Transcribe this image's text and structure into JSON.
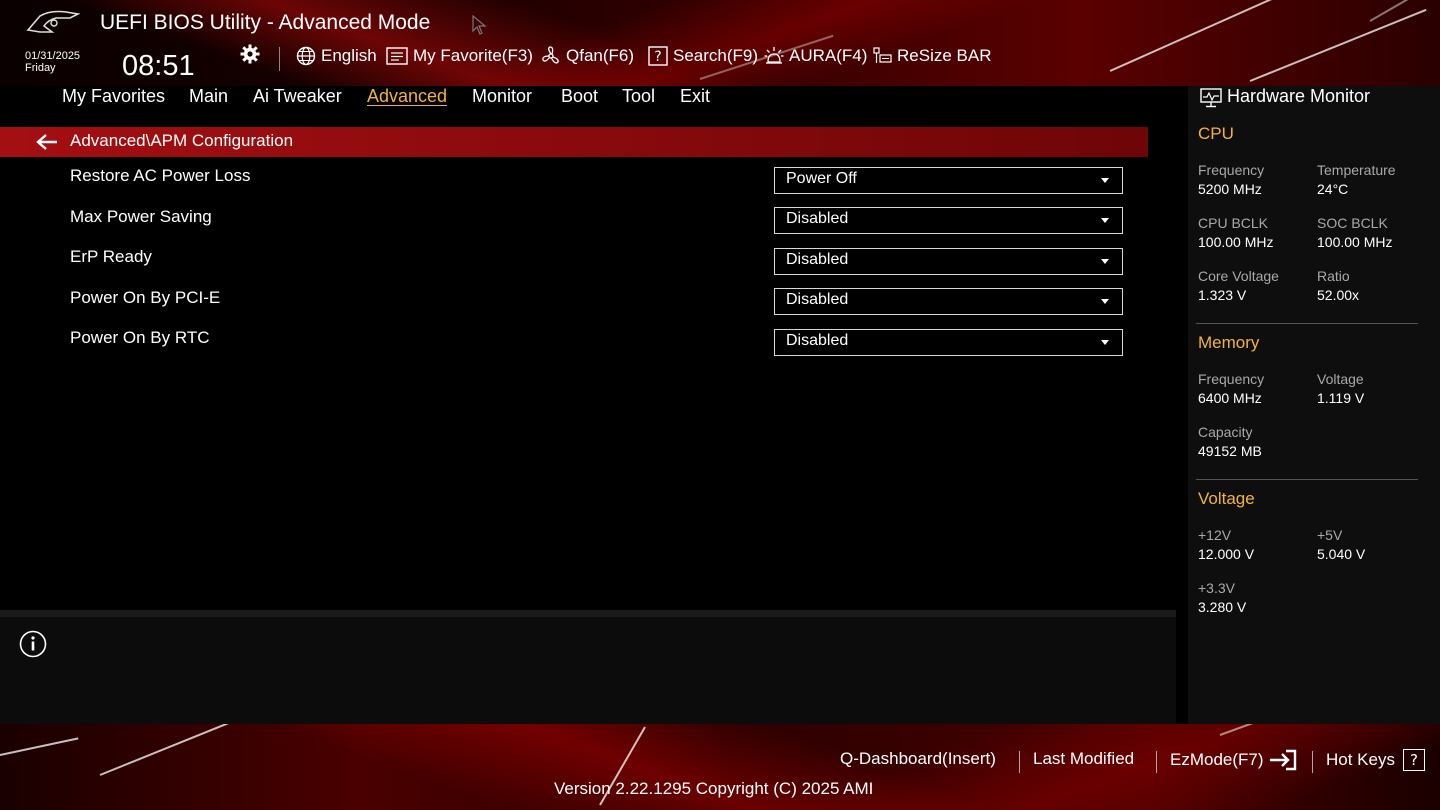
{
  "header": {
    "title": "UEFI BIOS Utility - Advanced Mode",
    "date": "01/31/2025",
    "day": "Friday",
    "time": "08:51"
  },
  "toolbar": {
    "items": [
      {
        "label": "English",
        "icon": "globe-icon"
      },
      {
        "label": "My Favorite(F3)",
        "icon": "favorite-list-icon"
      },
      {
        "label": "Qfan(F6)",
        "icon": "fan-icon"
      },
      {
        "label": "Search(F9)",
        "icon": "search-help-icon"
      },
      {
        "label": "AURA(F4)",
        "icon": "aura-light-icon"
      },
      {
        "label": "ReSize BAR",
        "icon": "resize-bar-icon"
      }
    ]
  },
  "menu": {
    "items": [
      "My Favorites",
      "Main",
      "Ai Tweaker",
      "Advanced",
      "Monitor",
      "Boot",
      "Tool",
      "Exit"
    ],
    "active": "Advanced"
  },
  "path": "Advanced\\APM Configuration",
  "settings": [
    {
      "label": "Restore AC Power Loss",
      "value": "Power Off"
    },
    {
      "label": "Max Power Saving",
      "value": "Disabled"
    },
    {
      "label": "ErP Ready",
      "value": "Disabled"
    },
    {
      "label": "Power On By PCI-E",
      "value": "Disabled"
    },
    {
      "label": "Power On By RTC",
      "value": "Disabled"
    }
  ],
  "hw_monitor": {
    "title": "Hardware Monitor",
    "cpu": {
      "heading": "CPU",
      "frequency_label": "Frequency",
      "frequency": "5200 MHz",
      "temperature_label": "Temperature",
      "temperature": "24°C",
      "cpu_bclk_label": "CPU BCLK",
      "cpu_bclk": "100.00 MHz",
      "soc_bclk_label": "SOC BCLK",
      "soc_bclk": "100.00 MHz",
      "core_voltage_label": "Core Voltage",
      "core_voltage": "1.323 V",
      "ratio_label": "Ratio",
      "ratio": "52.00x"
    },
    "memory": {
      "heading": "Memory",
      "frequency_label": "Frequency",
      "frequency": "6400 MHz",
      "voltage_label": "Voltage",
      "voltage": "1.119 V",
      "capacity_label": "Capacity",
      "capacity": "49152 MB"
    },
    "voltage": {
      "heading": "Voltage",
      "v12_label": "+12V",
      "v12": "12.000 V",
      "v5_label": "+5V",
      "v5": "5.040 V",
      "v33_label": "+3.3V",
      "v33": "3.280 V"
    }
  },
  "footer": {
    "q_dashboard": "Q-Dashboard(Insert)",
    "last_modified": "Last Modified",
    "ezmode": "EzMode(F7)",
    "hotkeys": "Hot Keys",
    "hotkeys_glyph": "?",
    "version": "Version 2.22.1295 Copyright (C) 2025 AMI"
  },
  "colors": {
    "accent": "#f2b33d",
    "path_bar": "#a40f12",
    "background": "#000000"
  }
}
